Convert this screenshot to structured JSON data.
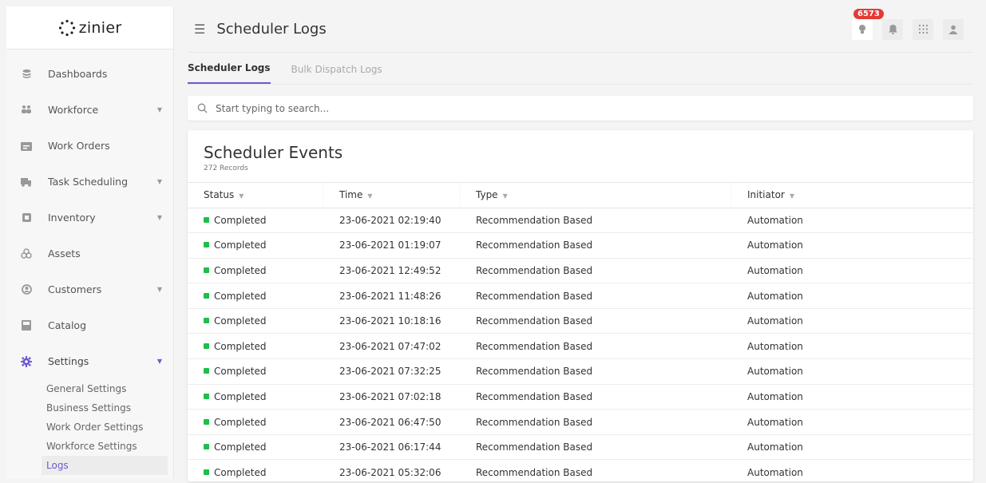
{
  "app": {
    "logo_text": "zinier"
  },
  "sidebar": {
    "items": [
      {
        "label": "Dashboards",
        "icon": "dashboard-icon",
        "has_caret": false
      },
      {
        "label": "Workforce",
        "icon": "people-icon",
        "has_caret": true
      },
      {
        "label": "Work Orders",
        "icon": "folder-icon",
        "has_caret": false
      },
      {
        "label": "Task Scheduling",
        "icon": "truck-icon",
        "has_caret": true
      },
      {
        "label": "Inventory",
        "icon": "inventory-icon",
        "has_caret": true
      },
      {
        "label": "Assets",
        "icon": "assets-icon",
        "has_caret": false
      },
      {
        "label": "Customers",
        "icon": "customer-icon",
        "has_caret": true
      },
      {
        "label": "Catalog",
        "icon": "catalog-icon",
        "has_caret": false
      },
      {
        "label": "Settings",
        "icon": "gear-icon",
        "has_caret": true
      }
    ],
    "settings_sub": [
      "General Settings",
      "Business Settings",
      "Work Order Settings",
      "Workforce Settings",
      "Logs"
    ]
  },
  "header": {
    "title": "Scheduler Logs",
    "badge_count": "6573"
  },
  "tabs": [
    {
      "label": "Scheduler Logs",
      "active": true
    },
    {
      "label": "Bulk Dispatch Logs",
      "active": false
    }
  ],
  "search": {
    "placeholder": "Start typing to search..."
  },
  "card": {
    "title": "Scheduler Events",
    "records": "272 Records"
  },
  "table": {
    "headers": [
      "Status",
      "Time",
      "Type",
      "Initiator"
    ],
    "rows": [
      [
        "Completed",
        "23-06-2021 02:19:40",
        "Recommendation Based",
        "Automation"
      ],
      [
        "Completed",
        "23-06-2021 01:19:07",
        "Recommendation Based",
        "Automation"
      ],
      [
        "Completed",
        "23-06-2021 12:49:52",
        "Recommendation Based",
        "Automation"
      ],
      [
        "Completed",
        "23-06-2021 11:48:26",
        "Recommendation Based",
        "Automation"
      ],
      [
        "Completed",
        "23-06-2021 10:18:16",
        "Recommendation Based",
        "Automation"
      ],
      [
        "Completed",
        "23-06-2021 07:47:02",
        "Recommendation Based",
        "Automation"
      ],
      [
        "Completed",
        "23-06-2021 07:32:25",
        "Recommendation Based",
        "Automation"
      ],
      [
        "Completed",
        "23-06-2021 07:02:18",
        "Recommendation Based",
        "Automation"
      ],
      [
        "Completed",
        "23-06-2021 06:47:50",
        "Recommendation Based",
        "Automation"
      ],
      [
        "Completed",
        "23-06-2021 06:17:44",
        "Recommendation Based",
        "Automation"
      ],
      [
        "Completed",
        "23-06-2021 05:32:06",
        "Recommendation Based",
        "Automation"
      ]
    ]
  },
  "colors": {
    "accent": "#6d5bd0",
    "status_completed": "#1fbe49",
    "badge": "#e53935"
  }
}
